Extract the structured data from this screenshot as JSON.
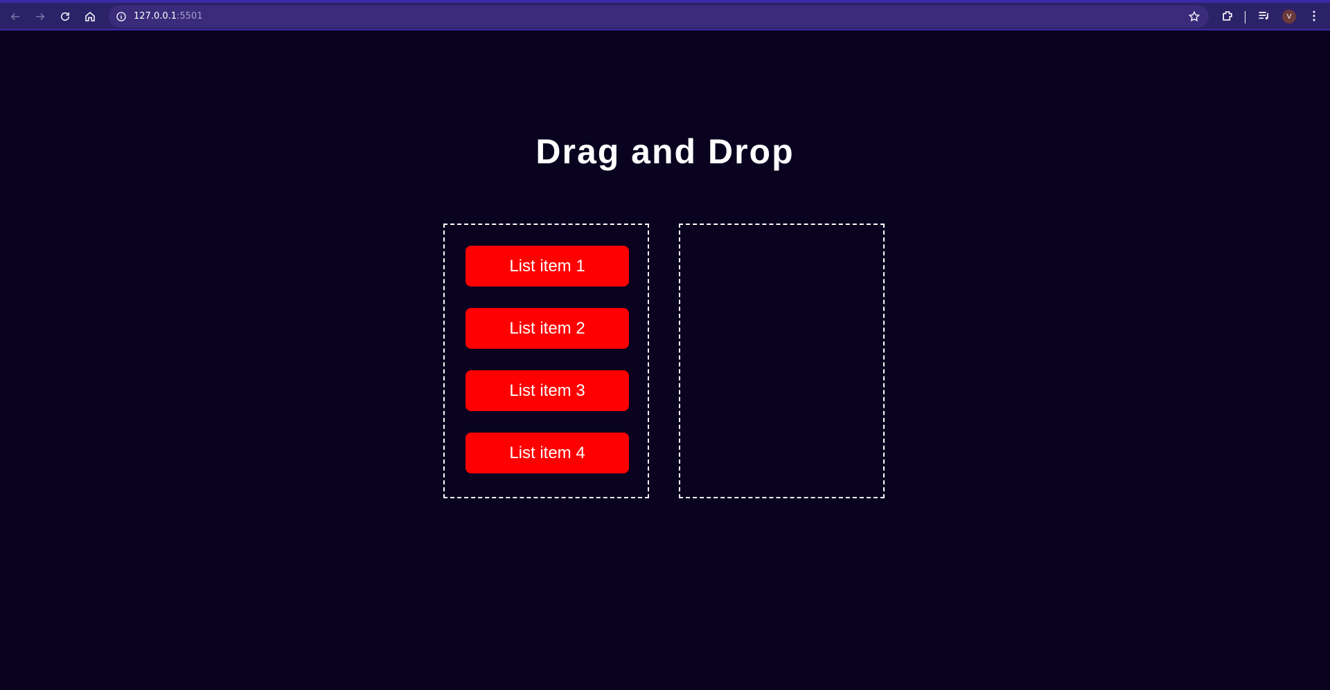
{
  "browser": {
    "url_host": "127.0.0.1",
    "url_port": ":5501",
    "profile_initial": "V"
  },
  "page": {
    "title": "Drag and Drop"
  },
  "list": {
    "items": [
      {
        "label": "List item 1"
      },
      {
        "label": "List item 2"
      },
      {
        "label": "List item 3"
      },
      {
        "label": "List item 4"
      }
    ]
  },
  "colors": {
    "background": "#0a0320",
    "item": "#ff0000",
    "browser_bar": "#2c2268"
  }
}
